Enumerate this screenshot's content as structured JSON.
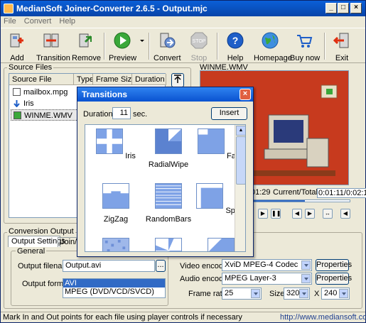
{
  "app": {
    "title": "MedianSoft Joiner-Converter 2.6.5 - Output.mjc",
    "minimize": "_",
    "maximize": "□",
    "close": "×"
  },
  "menu": [
    "File",
    "Convert",
    "Help"
  ],
  "toolbar": {
    "add": "Add",
    "transition": "Transition",
    "remove": "Remove",
    "preview": "Preview",
    "convert": "Convert",
    "stop": "Stop",
    "help": "Help",
    "homepage": "Homepage",
    "buy_now": "Buy now",
    "exit": "Exit",
    "stop_icon_text": "STOP",
    "help_icon_text": "?"
  },
  "source": {
    "group_label": "Source Files",
    "columns": [
      "Source File",
      "Type",
      "Frame Size",
      "Duration"
    ],
    "rows": [
      {
        "name": "mailbox.mpg",
        "type": "M"
      },
      {
        "name": "Iris",
        "type": ""
      },
      {
        "name": "WINME.WMV",
        "type": "W"
      }
    ]
  },
  "preview": {
    "title": "WINME.WMV",
    "time_elapsed": "01:29",
    "current_total_label": "Current/Total",
    "current_total_value": "0:01:11/0:02:11",
    "progress_fraction": 0.54
  },
  "conversion": {
    "group_label": "Conversion Output",
    "tabs": [
      "Output Settings",
      "Join/Co"
    ],
    "general_label": "General",
    "output_filename_label": "Output filename:",
    "output_filename_value": "Output.avi",
    "browse_label": "...",
    "output_format_label": "Output format:",
    "formats": [
      "AVI",
      "MPEG (DVD/VCD/SVCD)"
    ],
    "video_encoder_label": "Video encoder:",
    "video_encoder_value": "XviD MPEG-4 Codec",
    "audio_encoder_label": "Audio encoder:",
    "audio_encoder_value": "MPEG Layer-3",
    "properties_label": "Properties",
    "frame_rate_label": "Frame rate:",
    "frame_rate_value": "25",
    "size_label": "Size:",
    "width_value": "320",
    "x_label": "X",
    "height_value": "240"
  },
  "dialog": {
    "title": "Transitions",
    "close": "×",
    "duration_label": "Duration:",
    "duration_value": "11",
    "sec_label": "sec.",
    "insert_label": "Insert",
    "tiles": [
      "Iris",
      "RadialWipe",
      "Fade",
      "ZigZag",
      "RandomBars",
      "Spiral"
    ]
  },
  "status": {
    "message": "Mark In and Out points for each file using player controls if necessary",
    "url": "http://www.mediansoft.com"
  },
  "colors": {
    "accent": "#0a52d0",
    "selection": "#316ac5",
    "video_bg": "#c73a1e"
  }
}
